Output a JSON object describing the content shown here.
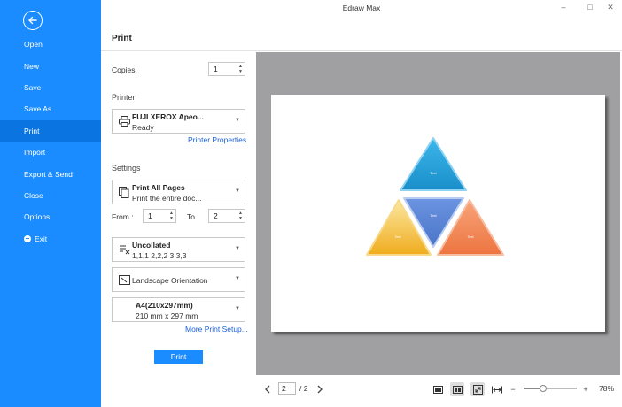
{
  "app": {
    "title": "Edraw Max"
  },
  "window_controls": {
    "minimize": "–",
    "maximize": "□",
    "close": "✕"
  },
  "sidebar": {
    "back_icon": "arrow-left-icon",
    "items": [
      {
        "label": "Open"
      },
      {
        "label": "New"
      },
      {
        "label": "Save"
      },
      {
        "label": "Save As"
      },
      {
        "label": "Print",
        "active": true
      },
      {
        "label": "Import"
      },
      {
        "label": "Export & Send"
      },
      {
        "label": "Close"
      },
      {
        "label": "Options"
      },
      {
        "label": "Exit",
        "icon": "exit-icon"
      }
    ]
  },
  "page": {
    "title": "Print"
  },
  "settings": {
    "copies_label": "Copies:",
    "copies_value": "1",
    "printer_section": "Printer",
    "printer_name": "FUJI XEROX Apeo...",
    "printer_status": "Ready",
    "printer_properties_link": "Printer Properties",
    "settings_section": "Settings",
    "pages_title": "Print All Pages",
    "pages_desc": "Print the entire doc...",
    "from_label": "From :",
    "from_value": "1",
    "to_label": "To :",
    "to_value": "2",
    "collate_title": "Uncollated",
    "collate_desc": "1,1,1   2,2,2   3,3,3",
    "orientation": "Landscape Orientation",
    "paper_title": "A4(210x297mm)",
    "paper_desc": "210 mm x 297 mm",
    "more_setup_link": "More Print Setup...",
    "print_button": "Print"
  },
  "preview": {
    "diagram": {
      "labels": {
        "top": "Text",
        "center": "Text",
        "left": "Text",
        "right": "Text"
      },
      "colors": {
        "top": "#29a3dc",
        "center": "#5b86d6",
        "left": "#f2b430",
        "right": "#f08a5a"
      }
    }
  },
  "footer": {
    "current_page": "2",
    "total_pages": "/ 2",
    "zoom": "78%",
    "zoom_level": 0.36
  }
}
